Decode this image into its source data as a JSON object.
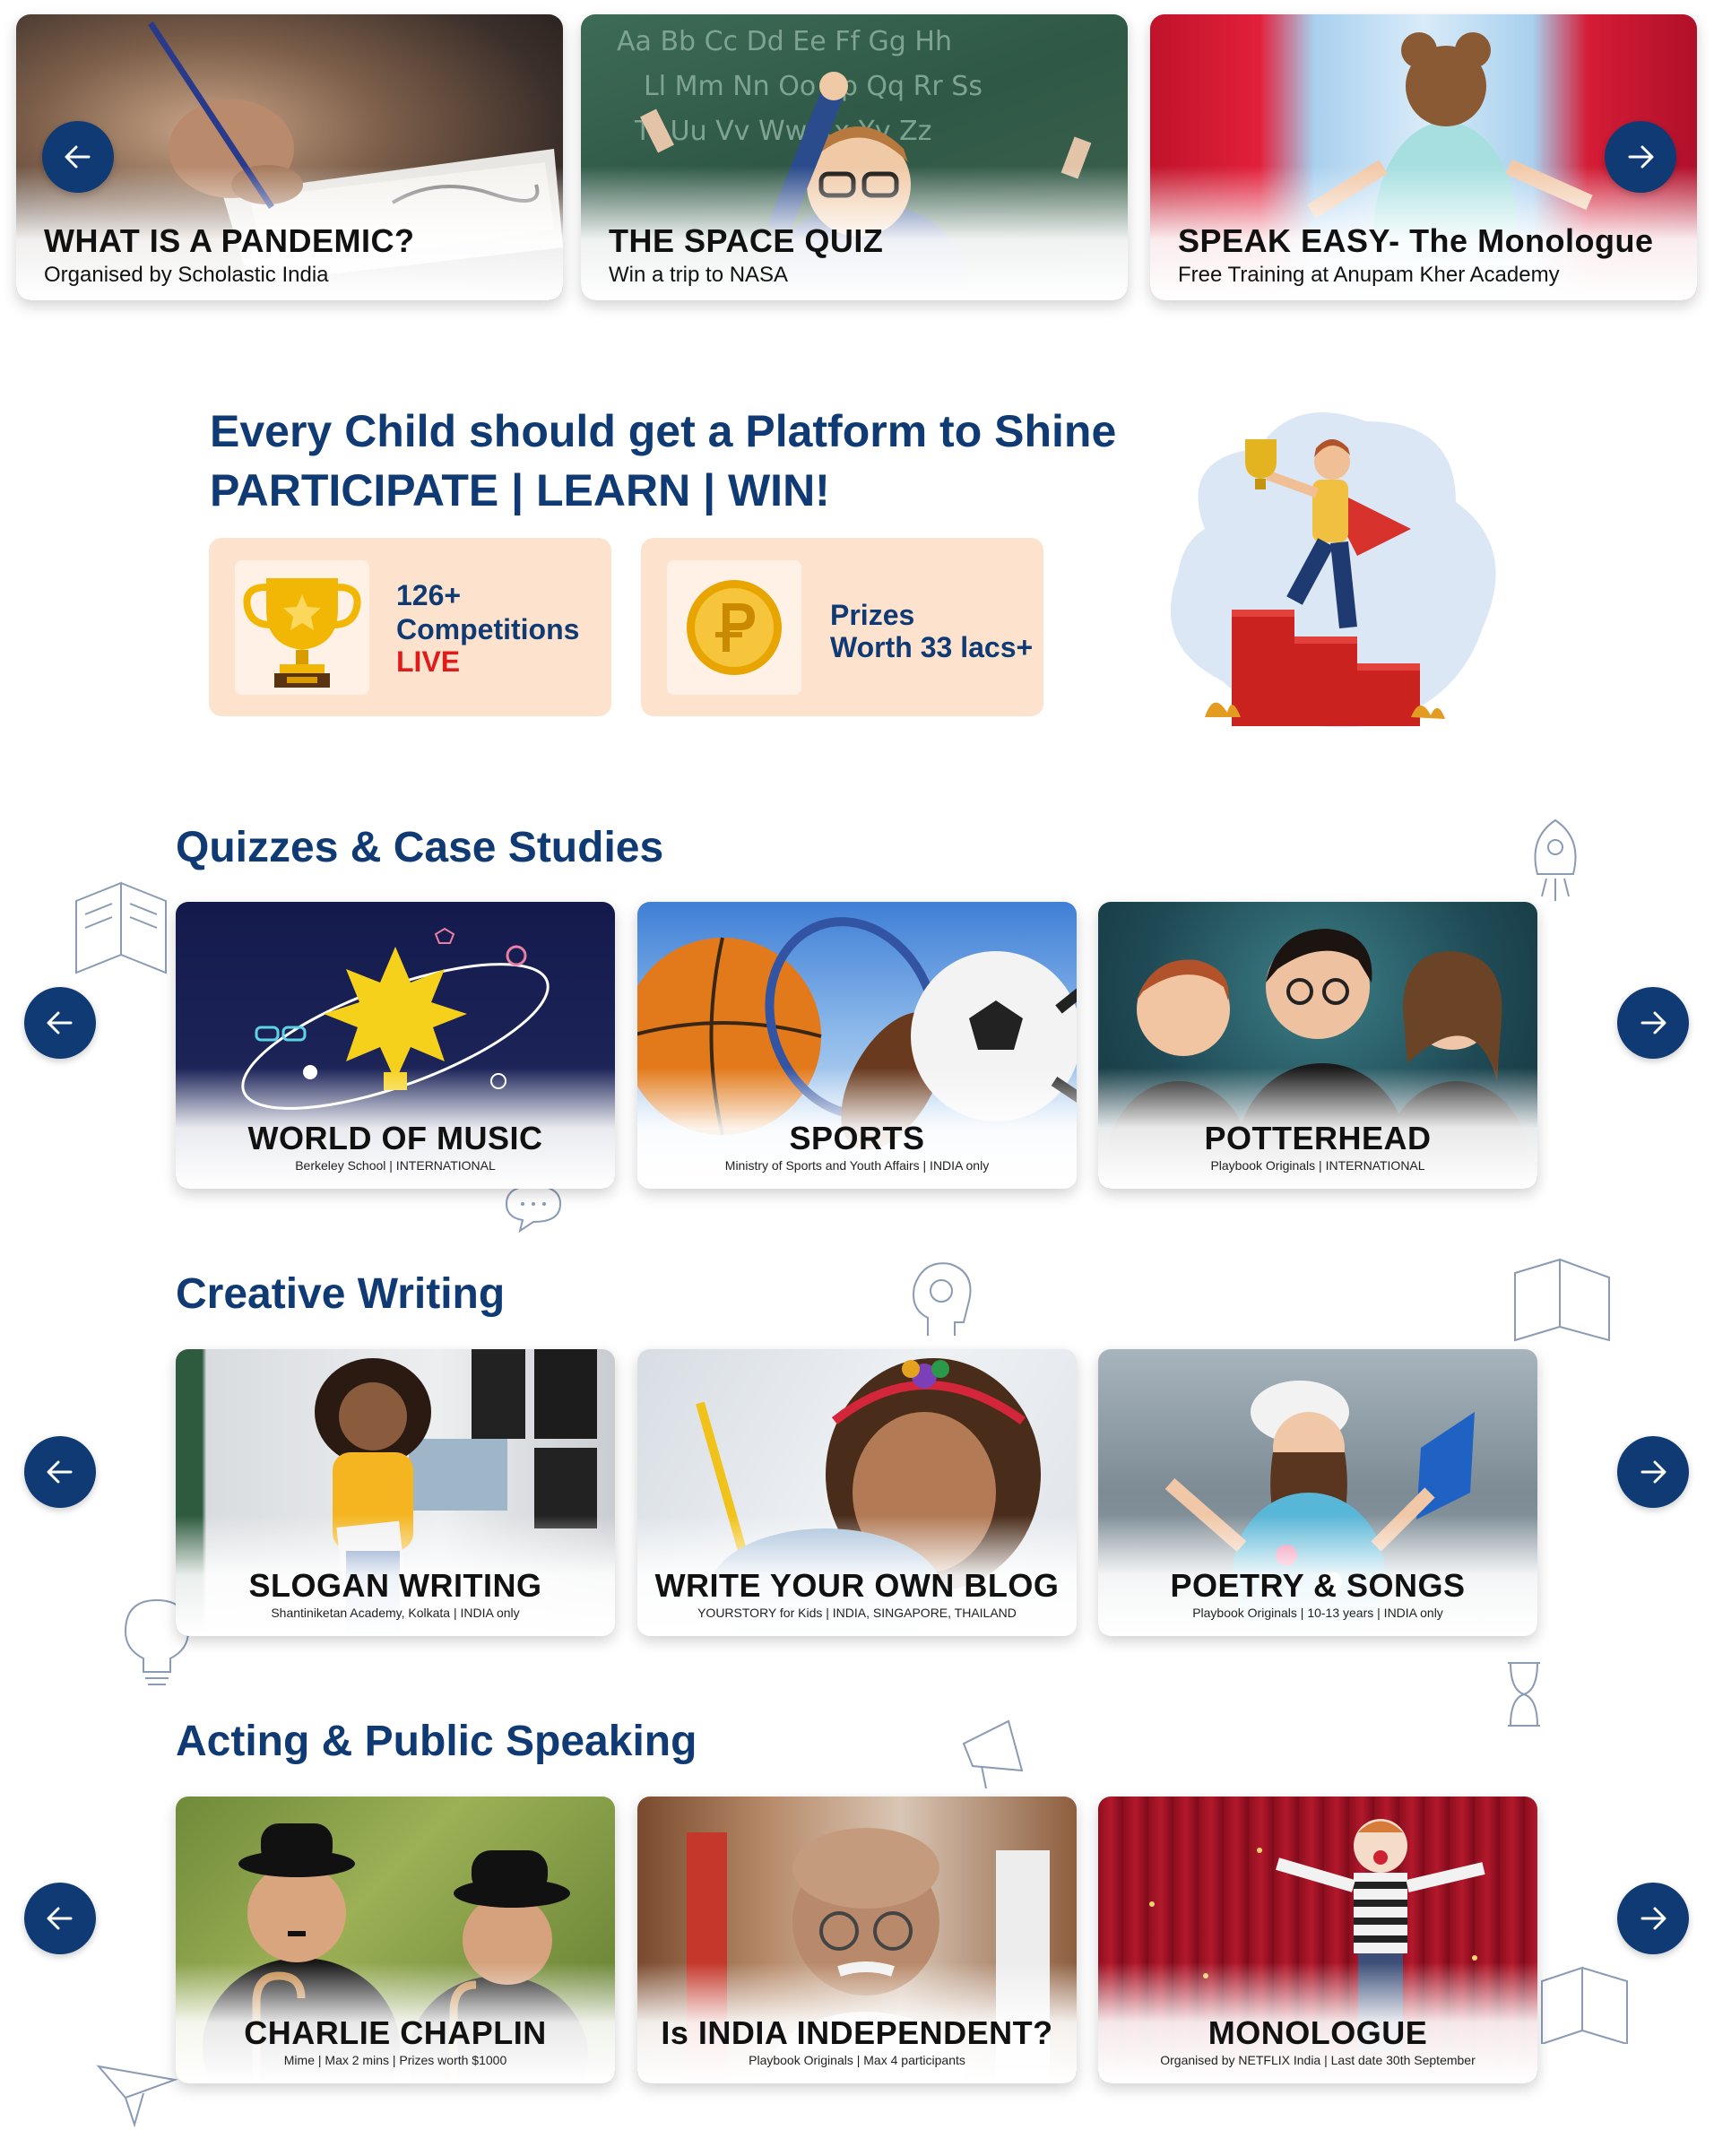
{
  "top_carousel": {
    "cards": [
      {
        "title": "WHAT IS A PANDEMIC?",
        "subtitle": "Organised by Scholastic India"
      },
      {
        "title": "THE SPACE QUIZ",
        "subtitle": "Win a trip to NASA"
      },
      {
        "title": "SPEAK EASY- The Monologue",
        "subtitle": "Free Training at Anupam Kher Academy"
      }
    ],
    "prev_icon": "arrow-left-icon",
    "next_icon": "arrow-right-icon"
  },
  "hero": {
    "headline": "Every Child should get a Platform to Shine",
    "tagline": "PARTICIPATE | LEARN | WIN!",
    "stats": {
      "competitions": {
        "count": "126+",
        "label": "Competitions",
        "status": "LIVE",
        "icon": "trophy-icon"
      },
      "prizes": {
        "label": "Prizes",
        "value": "Worth 33 lacs+",
        "icon": "coin-icon"
      }
    }
  },
  "sections": {
    "quizzes": {
      "title": "Quizzes & Case Studies",
      "cards": [
        {
          "title": "WORLD OF MUSIC",
          "subtitle": "Berkeley School | INTERNATIONAL"
        },
        {
          "title": "SPORTS",
          "subtitle": "Ministry of Sports and Youth Affairs | INDIA only"
        },
        {
          "title": "POTTERHEAD",
          "subtitle": "Playbook Originals | INTERNATIONAL"
        }
      ]
    },
    "writing": {
      "title": "Creative Writing",
      "cards": [
        {
          "title": "SLOGAN WRITING",
          "subtitle": "Shantiniketan Academy, Kolkata | INDIA only"
        },
        {
          "title": "WRITE YOUR OWN BLOG",
          "subtitle": "YOURSTORY for Kids | INDIA, SINGAPORE, THAILAND"
        },
        {
          "title": "POETRY & SONGS",
          "subtitle": "Playbook Originals | 10-13 years | INDIA only"
        }
      ]
    },
    "acting": {
      "title": "Acting & Public Speaking",
      "cards": [
        {
          "title": "CHARLIE CHAPLIN",
          "subtitle": "Mime | Max 2 mins | Prizes worth $1000"
        },
        {
          "title": "Is INDIA INDEPENDENT?",
          "subtitle": "Playbook Originals | Max 4 participants"
        },
        {
          "title": "MONOLOGUE",
          "subtitle": "Organised by NETFLIX India | Last date 30th September"
        }
      ]
    }
  },
  "colors": {
    "brand_blue": "#0f3a74",
    "stat_background": "#fde3cd",
    "live_red": "#e01b1b"
  }
}
